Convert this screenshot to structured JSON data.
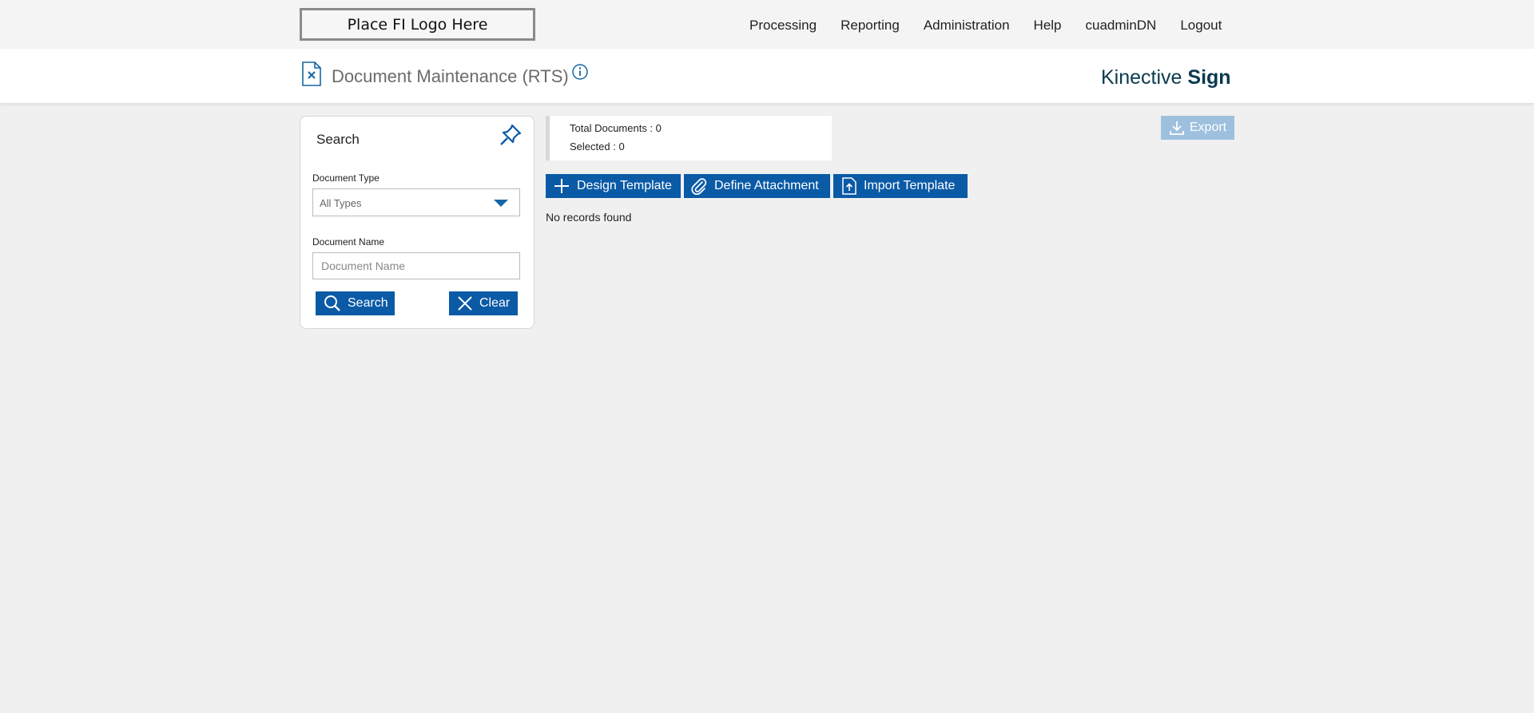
{
  "header": {
    "logo_text": "Place FI Logo Here",
    "nav": [
      "Processing",
      "Reporting",
      "Administration",
      "Help",
      "cuadminDN",
      "Logout"
    ]
  },
  "titlebar": {
    "page_title": "Document Maintenance (RTS)",
    "brand_light": "Kinective ",
    "brand_bold": "Sign"
  },
  "search": {
    "heading": "Search",
    "document_type_label": "Document Type",
    "document_type_value": "All Types",
    "document_name_label": "Document Name",
    "document_name_placeholder": "Document Name",
    "search_button": "Search",
    "clear_button": "Clear"
  },
  "stats": {
    "total_label": "Total Documents : ",
    "total_value": "0",
    "selected_label": "Selected : ",
    "selected_value": "0"
  },
  "actions": {
    "design_template": "Design Template",
    "define_attachment": "Define Attachment",
    "import_template": "Import Template",
    "export": "Export"
  },
  "results": {
    "empty_message": "No records found"
  },
  "colors": {
    "primary": "#0a5aa6",
    "export_disabled": "#9ec0de",
    "brand": "#0b3a4e"
  }
}
